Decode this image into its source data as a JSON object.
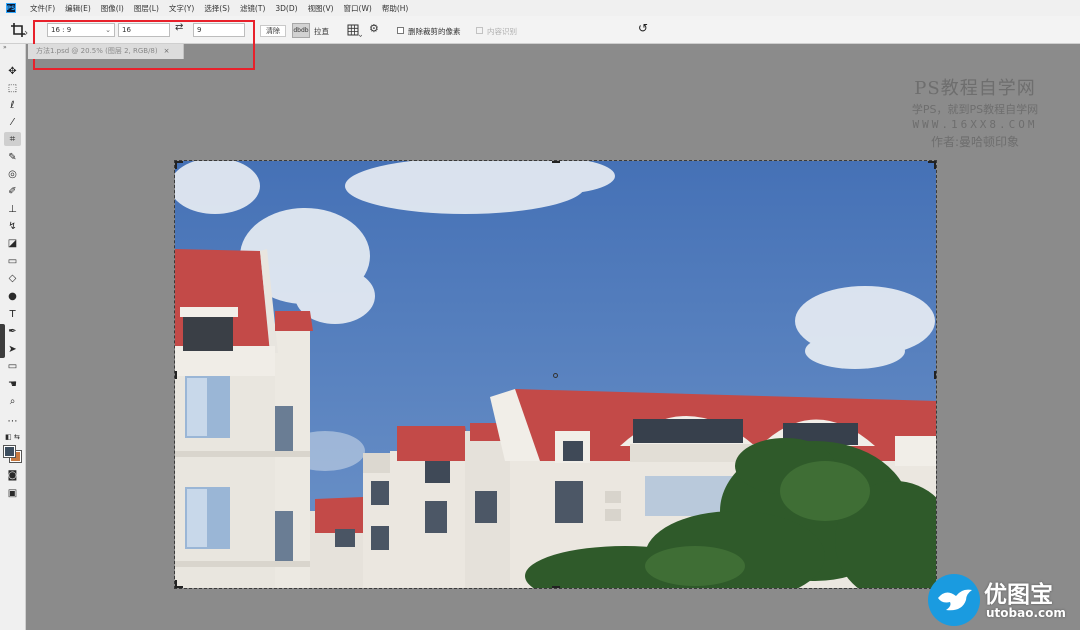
{
  "menubar": {
    "app_icon": "PS",
    "items": [
      "文件(F)",
      "编辑(E)",
      "图像(I)",
      "图层(L)",
      "文字(Y)",
      "选择(S)",
      "滤镜(T)",
      "3D(D)",
      "视图(V)",
      "窗口(W)",
      "帮助(H)"
    ]
  },
  "options": {
    "ratio_value": "16 : 9",
    "width_value": "16",
    "height_value": "9",
    "clear_label": "清除",
    "straighten_icon_text": "dbdb",
    "straighten_label": "拉直",
    "delete_pixels_label": "删除裁剪的像素",
    "content_aware_label": "内容识别"
  },
  "document": {
    "tab_title": "方法1.psd @ 20.5% (图层 2, RGB/8)",
    "close": "×"
  },
  "watermark": {
    "title": "PS教程自学网",
    "line2": "学PS，就到PS教程自学网",
    "line3": "WWW.16XX8.COM",
    "line4": "作者:曼哈顿印象"
  },
  "logo": {
    "name": "优图宝",
    "domain": "utobao.com"
  },
  "colors": {
    "highlight": "#e8212b",
    "foreground": "#3c4d5e",
    "background": "#c77940",
    "sky": "#4e7bbf",
    "roof": "#c34a48"
  },
  "tools": [
    "move-icon",
    "marquee-icon",
    "lasso-icon",
    "magic-wand-icon",
    "crop-icon",
    "eyedropper-icon",
    "healing-brush-icon",
    "brush-icon",
    "clone-stamp-icon",
    "history-brush-icon",
    "eraser-icon",
    "gradient-icon",
    "blur-icon",
    "dodge-icon",
    "pen-icon",
    "type-icon",
    "path-selection-icon",
    "rectangle-icon",
    "hand-icon",
    "zoom-icon",
    "more-tools-icon"
  ]
}
